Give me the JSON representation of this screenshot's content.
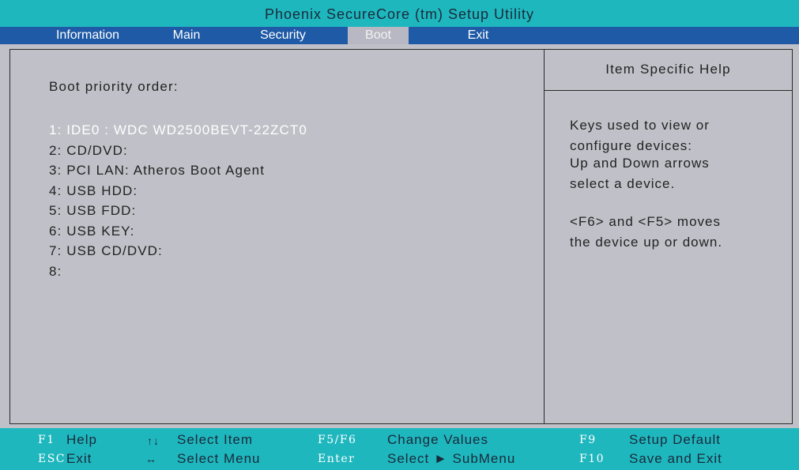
{
  "title": "Phoenix SecureCore (tm) Setup Utility",
  "menu": {
    "items": [
      {
        "label": "Information"
      },
      {
        "label": "Main"
      },
      {
        "label": "Security"
      },
      {
        "label": "Boot"
      },
      {
        "label": "Exit"
      }
    ],
    "active": "Boot"
  },
  "boot": {
    "heading": "Boot priority order:",
    "items": [
      {
        "label": "1: IDE0 : WDC WD2500BEVT-22ZCT0",
        "selected": true
      },
      {
        "label": "2: CD/DVD:"
      },
      {
        "label": "3: PCI LAN: Atheros Boot Agent"
      },
      {
        "label": "4: USB HDD:"
      },
      {
        "label": "5: USB FDD:"
      },
      {
        "label": "6: USB KEY:"
      },
      {
        "label": "7: USB CD/DVD:"
      },
      {
        "label": "8:"
      }
    ]
  },
  "help": {
    "title": "Item Specific Help",
    "paragraph1": [
      "Keys used to view or",
      "configure devices:",
      "Up and Down arrows",
      "select a device."
    ],
    "paragraph2": [
      "<F6> and <F5> moves",
      "the device up or down."
    ]
  },
  "footer": {
    "rows": [
      [
        {
          "key": "F1",
          "desc": "Help"
        },
        {
          "key": "↑↓",
          "desc": "Select  Item"
        },
        {
          "key": "F5/F6",
          "desc": "Change Values"
        },
        {
          "key": "F9",
          "desc": "Setup  Default"
        }
      ],
      [
        {
          "key": "ESC",
          "desc": "Exit"
        },
        {
          "key": "↔",
          "desc": "Select  Menu"
        },
        {
          "key": "Enter",
          "desc": "Select ► SubMenu"
        },
        {
          "key": "F10",
          "desc": "Save  and  Exit"
        }
      ]
    ]
  },
  "colors": {
    "title_bg": "#1fb7be",
    "menu_bg": "#1e5aa6",
    "panel_bg": "#c0c0c8",
    "selected_text": "#ffffff"
  }
}
